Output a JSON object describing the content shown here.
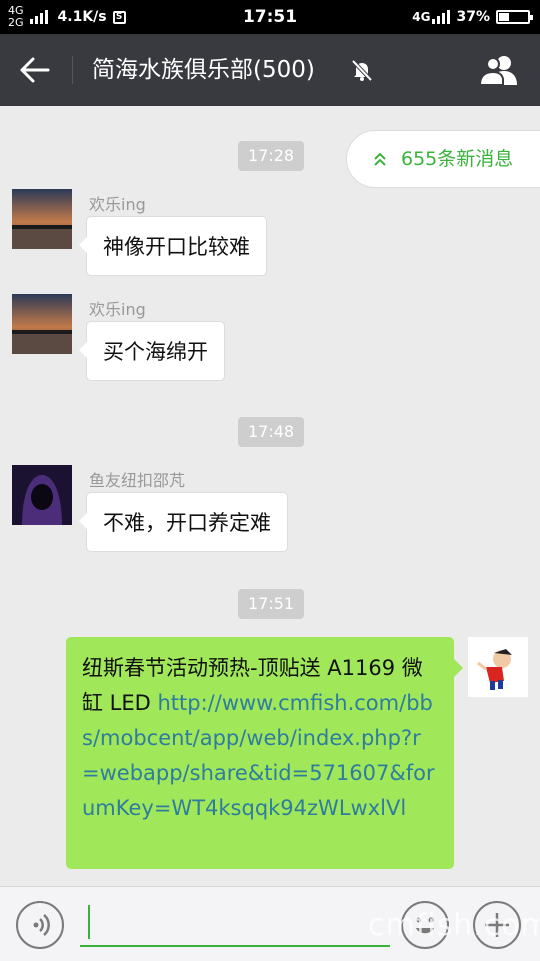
{
  "status_bar": {
    "net_top": "4G",
    "net_bottom": "2G",
    "speed": "4.1K/s",
    "time": "17:51",
    "net_right": "4G",
    "battery_text": "37%",
    "battery_level": 0.37
  },
  "header": {
    "title": "简海水族俱乐部(500)",
    "back_icon": "arrow-left-icon",
    "mute_icon": "bell-off-icon",
    "members_icon": "people-icon"
  },
  "new_messages": {
    "label": "655条新消息",
    "icon": "double-chevron-up-icon"
  },
  "chat": {
    "times": [
      "17:28",
      "17:48",
      "17:51"
    ],
    "messages": [
      {
        "sender": "欢乐ing",
        "text": "神像开口比较难"
      },
      {
        "sender": "欢乐ing",
        "text": "买个海绵开"
      },
      {
        "sender": "鱼友纽扣邵芃",
        "text": "不难，开口养定难"
      }
    ],
    "mine": {
      "text": "纽斯春节活动预热-顶贴送 A1169 微缸 LED ",
      "link": "http://www.cmfish.com/bbs/mobcent/app/web/index.php?r=webapp/share&tid=571607&forumKey=WT4ksqqk94zWLwxlVl"
    }
  },
  "input_bar": {
    "voice_icon": "voice-icon",
    "emoji_icon": "smiley-icon",
    "plus_icon": "plus-icon"
  },
  "watermark": "cmfish.com",
  "colors": {
    "header_bg": "#393a3f",
    "chat_bg": "#ebebeb",
    "my_bubble": "#a0e75a",
    "accent_green": "#3bb33b",
    "link": "#2f7d9e"
  }
}
